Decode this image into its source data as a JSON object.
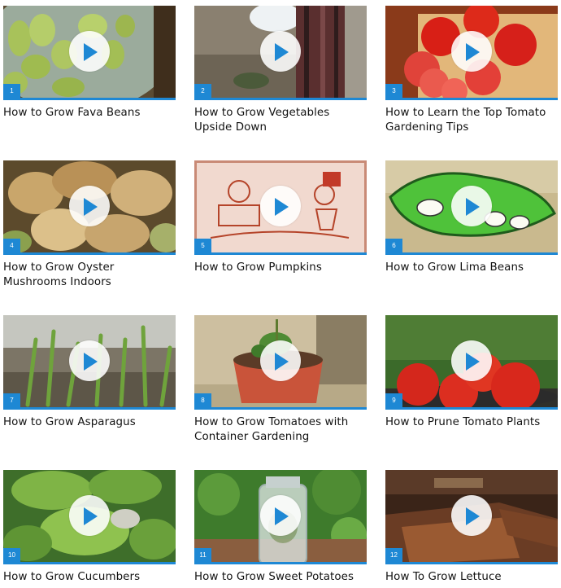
{
  "videos": [
    {
      "number": "1",
      "title": "How to Grow Fava Beans"
    },
    {
      "number": "2",
      "title": "How to Grow Vegetables Upside Down"
    },
    {
      "number": "3",
      "title": "How to Learn the Top Tomato Gardening Tips"
    },
    {
      "number": "4",
      "title": "How to Grow Oyster Mushrooms Indoors"
    },
    {
      "number": "5",
      "title": "How to Grow Pumpkins"
    },
    {
      "number": "6",
      "title": "How to Grow Lima Beans"
    },
    {
      "number": "7",
      "title": "How to Grow Asparagus"
    },
    {
      "number": "8",
      "title": "How to Grow Tomatoes with Container Gardening"
    },
    {
      "number": "9",
      "title": "How to Prune Tomato Plants"
    },
    {
      "number": "10",
      "title": "How to Grow Cucumbers"
    },
    {
      "number": "11",
      "title": "How to Grow Sweet Potatoes"
    },
    {
      "number": "12",
      "title": "How To Grow Lettuce"
    }
  ],
  "colors": {
    "accent": "#1e88d4",
    "play_icon": "#1e88d4",
    "play_circle": "#ffffff"
  },
  "icons": {
    "play": "play-icon"
  }
}
